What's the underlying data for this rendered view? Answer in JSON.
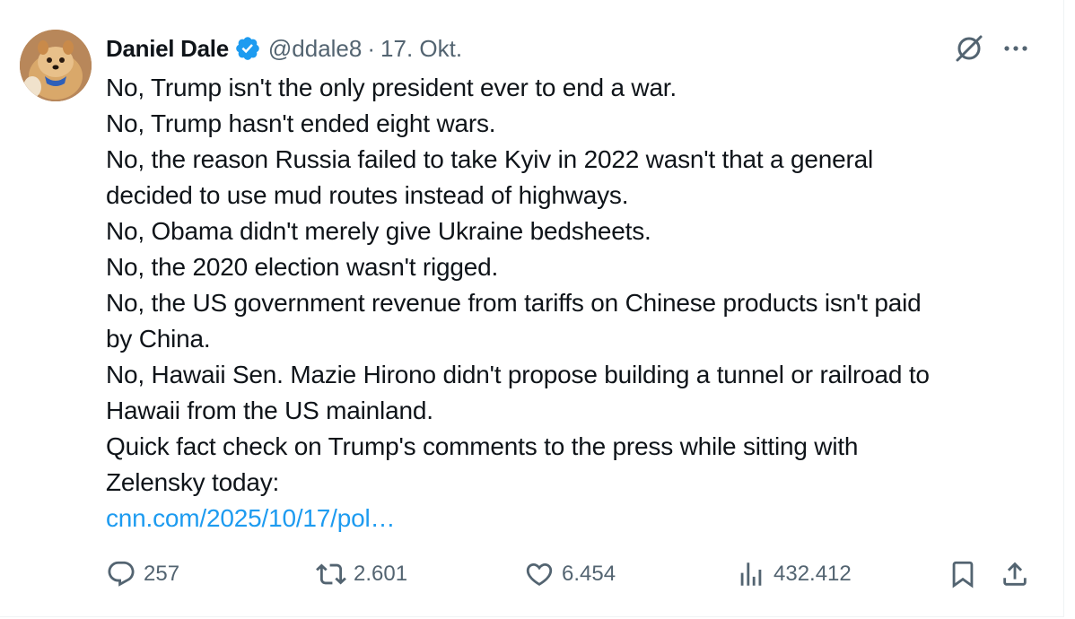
{
  "author": {
    "name": "Daniel Dale",
    "handle": "@ddale8",
    "separator": "·",
    "date": "17. Okt.",
    "verified_color": "#1d9bf0"
  },
  "tweet": {
    "lines": [
      "No, Trump isn't the only president ever to end a war.",
      "No, Trump hasn't ended eight wars.",
      "No, the reason Russia failed to take Kyiv in 2022 wasn't that a general",
      "decided to use mud routes instead of highways.",
      "No, Obama didn't merely give Ukraine bedsheets.",
      "No, the 2020 election wasn't rigged.",
      "No, the US government revenue from tariffs on Chinese products isn't paid",
      "by China.",
      "No, Hawaii Sen. Mazie Hirono didn't propose building a tunnel or railroad to",
      "Hawaii from the US mainland.",
      "Quick fact check on Trump's comments to the press while sitting with",
      "Zelensky today:"
    ],
    "link_text": "cnn.com/2025/10/17/pol…",
    "link_color": "#1d9bf0"
  },
  "icons": {
    "avatar": "avatar-pomeranian",
    "grok": "grok-icon",
    "more": "more-icon",
    "reply": "reply-icon",
    "repost": "repost-icon",
    "like": "heart-icon",
    "views": "views-icon",
    "bookmark": "bookmark-icon",
    "share": "share-icon"
  },
  "stats": {
    "replies": "257",
    "reposts": "2.601",
    "likes": "6.454",
    "views": "432.412"
  }
}
